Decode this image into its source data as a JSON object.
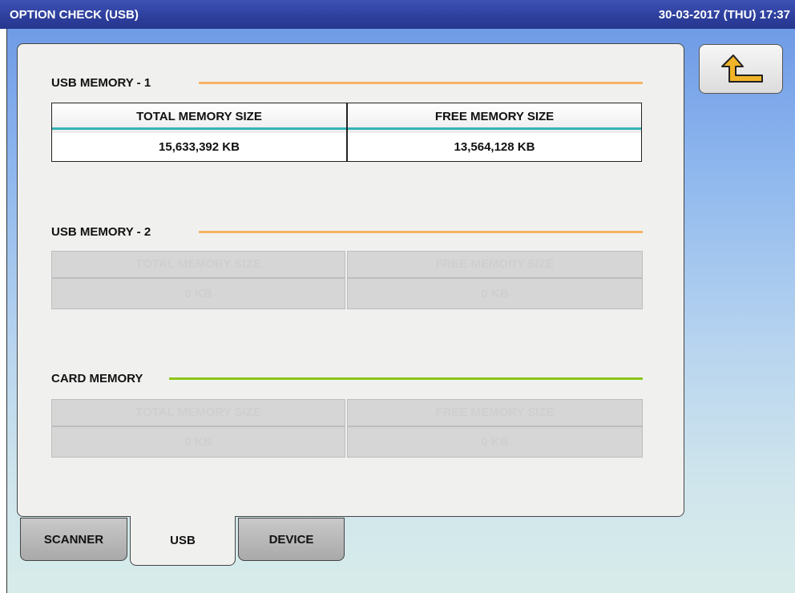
{
  "title_bar": {
    "title": "OPTION CHECK (USB)",
    "datetime": "30-03-2017 (THU)  17:37"
  },
  "back_button": {
    "icon": "return-arrow-icon",
    "color": "#f0b429"
  },
  "sections": {
    "usb1": {
      "label": "USB MEMORY - 1",
      "line_color": "#f5b463",
      "enabled": true,
      "total_header": "TOTAL MEMORY SIZE",
      "free_header": "FREE MEMORY SIZE",
      "total_value": "15,633,392 KB",
      "free_value": "13,564,128 KB"
    },
    "usb2": {
      "label": "USB MEMORY - 2",
      "line_color": "#f5b463",
      "enabled": false,
      "total_header": "TOTAL MEMORY SIZE",
      "free_header": "FREE MEMORY SIZE",
      "total_value": "0 KB",
      "free_value": "0 KB"
    },
    "card": {
      "label": "CARD MEMORY",
      "line_color": "#8cc51a",
      "enabled": false,
      "total_header": "TOTAL MEMORY SIZE",
      "free_header": "FREE MEMORY SIZE",
      "total_value": "0 KB",
      "free_value": "0 KB"
    }
  },
  "tabs": [
    {
      "label": "SCANNER",
      "selected": false
    },
    {
      "label": "USB",
      "selected": true
    },
    {
      "label": "DEVICE",
      "selected": false
    }
  ],
  "colors": {
    "header_accent": "#35b4b6"
  }
}
